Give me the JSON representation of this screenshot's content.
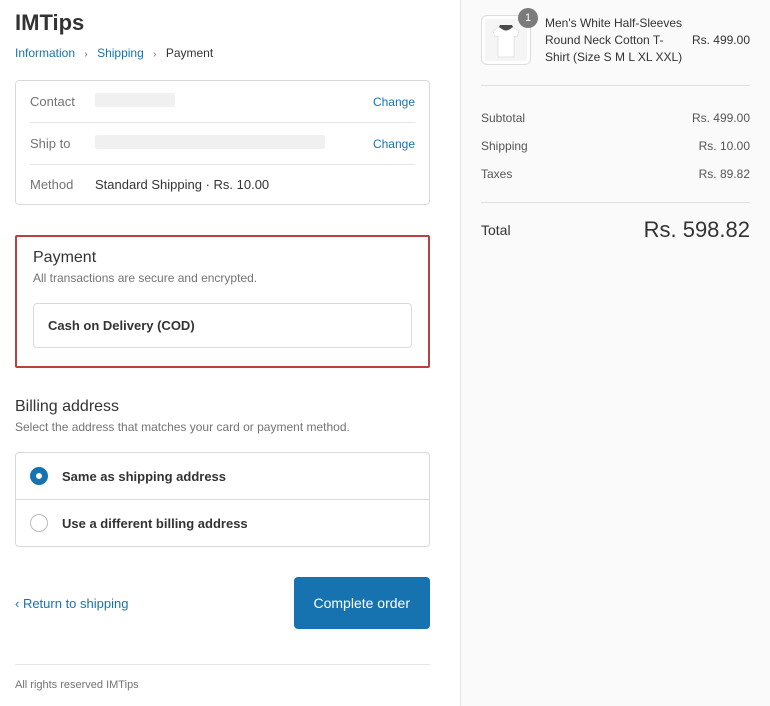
{
  "store_name": "IMTips",
  "breadcrumb": {
    "information": "Information",
    "shipping": "Shipping",
    "payment": "Payment"
  },
  "review": {
    "contact_label": "Contact",
    "shipto_label": "Ship to",
    "method_label": "Method",
    "method_value": "Standard Shipping · Rs. 10.00",
    "change_label": "Change"
  },
  "payment": {
    "heading": "Payment",
    "subtext": "All transactions are secure and encrypted.",
    "option_label": "Cash on Delivery (COD)"
  },
  "billing": {
    "heading": "Billing address",
    "subtext": "Select the address that matches your card or payment method.",
    "same_label": "Same as shipping address",
    "different_label": "Use a different billing address"
  },
  "actions": {
    "return_label": "‹ Return to shipping",
    "complete_label": "Complete order"
  },
  "footer": "All rights reserved IMTips",
  "order": {
    "product_name": "Men's White Half-Sleeves Round Neck Cotton T-Shirt (Size S M L XL XXL)",
    "product_qty": "1",
    "product_price": "Rs. 499.00",
    "subtotal_label": "Subtotal",
    "subtotal_value": "Rs. 499.00",
    "shipping_label": "Shipping",
    "shipping_value": "Rs. 10.00",
    "taxes_label": "Taxes",
    "taxes_value": "Rs. 89.82",
    "total_label": "Total",
    "total_value": "Rs. 598.82"
  }
}
